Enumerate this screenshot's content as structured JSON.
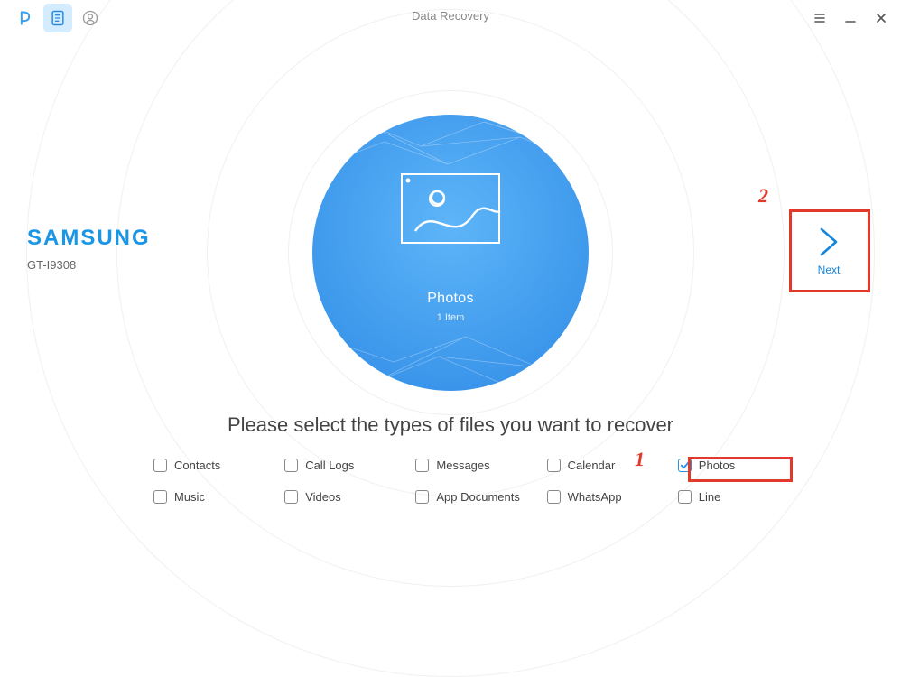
{
  "window": {
    "title": "Data Recovery"
  },
  "device": {
    "brand": "SAMSUNG",
    "model": "GT-I9308"
  },
  "center": {
    "title": "Photos",
    "subtitle": "1 Item"
  },
  "next": {
    "label": "Next"
  },
  "instruction": "Please select the types of files you want to recover",
  "types": [
    {
      "label": "Contacts",
      "checked": false
    },
    {
      "label": "Call Logs",
      "checked": false
    },
    {
      "label": "Messages",
      "checked": false
    },
    {
      "label": "Calendar",
      "checked": false
    },
    {
      "label": "Photos",
      "checked": true
    },
    {
      "label": "Music",
      "checked": false
    },
    {
      "label": "Videos",
      "checked": false
    },
    {
      "label": "App Documents",
      "checked": false
    },
    {
      "label": "WhatsApp",
      "checked": false
    },
    {
      "label": "Line",
      "checked": false
    }
  ],
  "annotations": {
    "num1": "1",
    "num2": "2"
  }
}
